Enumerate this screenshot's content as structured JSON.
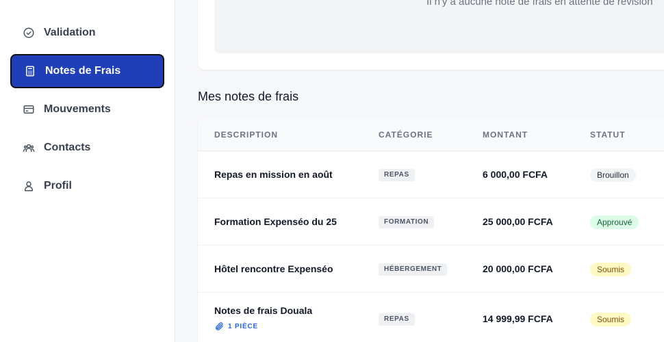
{
  "sidebar": {
    "items": [
      {
        "label": "Validation",
        "icon": "check-circle-icon"
      },
      {
        "label": "Notes de Frais",
        "icon": "calculator-icon",
        "active": true
      },
      {
        "label": "Mouvements",
        "icon": "credit-card-icon"
      },
      {
        "label": "Contacts",
        "icon": "users-icon"
      },
      {
        "label": "Profil",
        "icon": "user-icon"
      }
    ]
  },
  "pending": {
    "message": "Il n'y a aucune note de frais en attente de révision"
  },
  "expenses": {
    "title": "Mes notes de frais",
    "columns": [
      "DESCRIPTION",
      "CATÉGORIE",
      "MONTANT",
      "STATUT"
    ],
    "rows": [
      {
        "description": "Repas en mission en août",
        "category": "REPAS",
        "amount": "6 000,00 FCFA",
        "status": "Brouillon",
        "attachment": ""
      },
      {
        "description": "Formation Expenséo du 25",
        "category": "FORMATION",
        "amount": "25 000,00 FCFA",
        "status": "Approuvé",
        "attachment": ""
      },
      {
        "description": "Hôtel rencontre Expenséo",
        "category": "HÉBERGEMENT",
        "amount": "20 000,00 FCFA",
        "status": "Soumis",
        "attachment": ""
      },
      {
        "description": "Notes de frais Douala",
        "category": "REPAS",
        "amount": "14 999,99 FCFA",
        "status": "Soumis",
        "attachment": "1 PIÈCE"
      }
    ]
  },
  "colors": {
    "accent": "#1e3fb8",
    "status_draft_bg": "#f3f4f6",
    "status_approved_bg": "#dcfce7",
    "status_submitted_bg": "#fef9c3"
  }
}
